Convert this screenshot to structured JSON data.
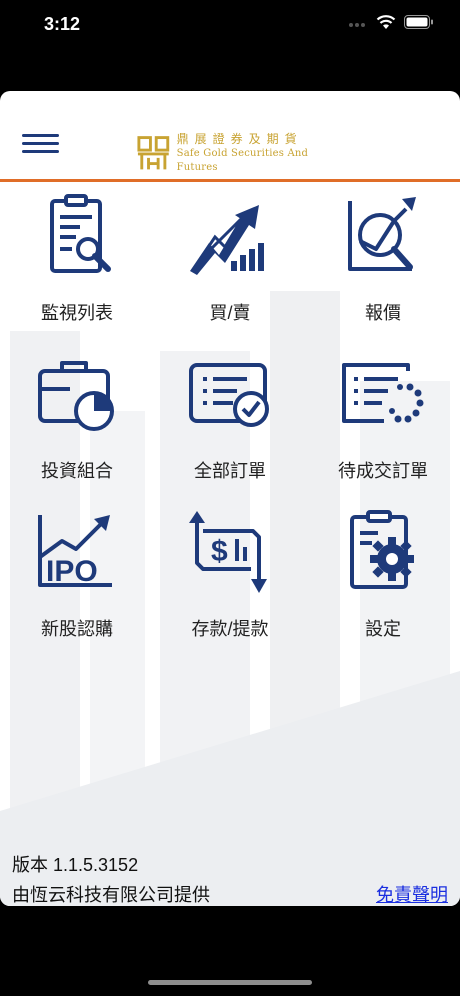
{
  "status": {
    "time": "3:12"
  },
  "header": {
    "logo_chinese": "鼎展證券及期貨",
    "logo_english": "Safe Gold Securities And Futures"
  },
  "menu": [
    {
      "label": "監視列表",
      "icon": "watchlist-icon"
    },
    {
      "label": "買/賣",
      "icon": "buy-sell-icon"
    },
    {
      "label": "報價",
      "icon": "quote-icon"
    },
    {
      "label": "投資組合",
      "icon": "portfolio-icon"
    },
    {
      "label": "全部訂單",
      "icon": "all-orders-icon"
    },
    {
      "label": "待成交訂單",
      "icon": "pending-orders-icon"
    },
    {
      "label": "新股認購",
      "icon": "ipo-icon"
    },
    {
      "label": "存款/提款",
      "icon": "deposit-withdraw-icon"
    },
    {
      "label": "設定",
      "icon": "settings-icon"
    }
  ],
  "footer": {
    "version": "版本 1.1.5.3152",
    "provider": "由恆云科技有限公司提供",
    "disclaimer": "免責聲明"
  },
  "colors": {
    "icon_blue": "#1e3a7a",
    "accent_orange": "#e06d28",
    "logo_gold": "#c8a332",
    "link_blue": "#1a2ee0"
  }
}
